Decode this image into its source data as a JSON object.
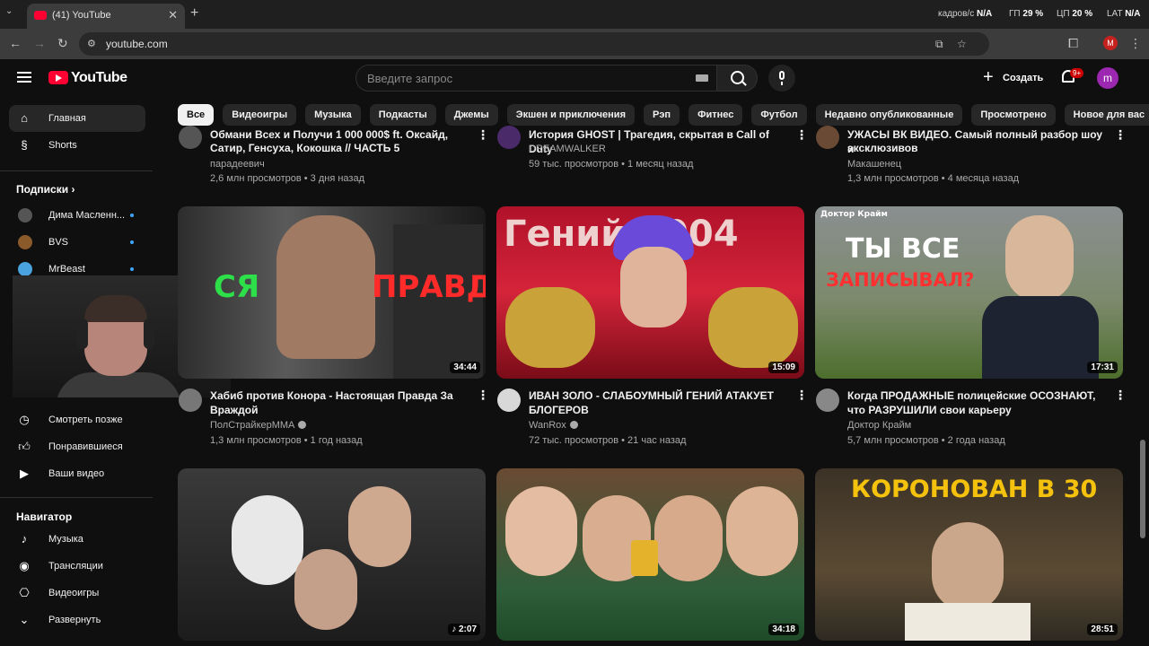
{
  "browser": {
    "tab_title": "(41) YouTube",
    "url": "youtube.com",
    "profile_initial": "M",
    "overlay_stats": {
      "fps_label": "кадров/с",
      "fps_value": "N/A",
      "gpu_label": "ГП",
      "gpu_value": "29 %",
      "cpu_label": "ЦП",
      "cpu_value": "20 %",
      "lat_label": "LAT",
      "lat_value": "N/A"
    }
  },
  "header": {
    "logo_text": "YouTube",
    "search_placeholder": "Введите запрос",
    "create_label": "Создать",
    "notifications_badge": "9+",
    "user_initial": "m"
  },
  "chips": [
    "Все",
    "Видеоигры",
    "Музыка",
    "Подкасты",
    "Джемы",
    "Экшен и приключения",
    "Рэп",
    "Фитнес",
    "Футбол",
    "Недавно опубликованные",
    "Просмотрено",
    "Новое для вас"
  ],
  "sidebar": {
    "main": [
      {
        "label": "Главная",
        "icon": "home-icon"
      },
      {
        "label": "Shorts",
        "icon": "shorts-icon"
      }
    ],
    "subscriptions_heading": "Подписки",
    "subscriptions": [
      {
        "label": "Дима Масленн...",
        "color": "#555"
      },
      {
        "label": "BVS",
        "color": "#8a5a2b"
      },
      {
        "label": "MrBeast",
        "color": "#4aa3df"
      }
    ],
    "you_items": [
      {
        "label": "Смотреть позже",
        "icon": "clock-icon"
      },
      {
        "label": "Понравившиеся",
        "icon": "thumb-up-icon"
      },
      {
        "label": "Ваши видео",
        "icon": "play-box-icon"
      }
    ],
    "navigator_heading": "Навигатор",
    "navigator": [
      {
        "label": "Музыка",
        "icon": "music-note-icon"
      },
      {
        "label": "Трансляции",
        "icon": "live-icon"
      },
      {
        "label": "Видеоигры",
        "icon": "gamepad-icon"
      },
      {
        "label": "Развернуть",
        "icon": "chevron-down-icon"
      }
    ]
  },
  "videos_top_row": [
    {
      "title_visible": "Сатир, Генсуха, Кокошка // ЧАСТЬ 5",
      "title_cut": "Обмани Всех и Получи 1 000 000$ ft. Оксайд,",
      "channel": "парадеевич",
      "meta": "2,6 млн просмотров • 3 дня назад"
    },
    {
      "title_visible": "",
      "title_cut": "История GHOST | Трагедия, скрытая в Call of Duty",
      "channel": "DREAMWALKER",
      "meta": "59 тыс. просмотров • 1 месяц назад"
    },
    {
      "title_visible": "эксклюзивов",
      "title_cut": "УЖАСЫ ВК ВИДЕО. Самый полный разбор шоу и",
      "channel": "Макашенец",
      "meta": "1,3 млн просмотров • 4 месяца назад"
    }
  ],
  "videos_mid_row": [
    {
      "title": "Хабиб против Конора - Настоящая Правда За Враждой",
      "channel": "ПолСтрайкерMMA",
      "verified": true,
      "meta": "1,3 млн просмотров • 1 год назад",
      "duration": "34:44",
      "thumb_text_left": "СЯ",
      "thumb_text_right": "ПРАВДА"
    },
    {
      "title": "ИВАН ЗОЛО - СЛАБОУМНЫЙ ГЕНИЙ АТАКУЕТ БЛОГЕРОВ",
      "channel": "WanRox",
      "verified": true,
      "meta": "72 тыс. просмотров • 21 час назад",
      "duration": "15:09",
      "thumb_text": "Гений 2004"
    },
    {
      "title": "Когда ПРОДАЖНЫЕ полицейские ОСОЗНАЮТ, что РАЗРУШИЛИ свои карьеру",
      "channel": "Доктор Крайм",
      "verified": false,
      "meta": "5,7 млн просмотров • 2 года назад",
      "duration": "17:31",
      "thumb_text_1": "ТЫ ВСЕ",
      "thumb_text_2": "ЗАПИСЫВАЛ?",
      "thumb_tag": "Доктор Крайм"
    }
  ],
  "videos_bottom_row": [
    {
      "duration": "2:07",
      "is_short_music": true
    },
    {
      "duration": "34:18"
    },
    {
      "duration": "28:51",
      "thumb_text": "КОРОНОВАН В 30"
    }
  ]
}
